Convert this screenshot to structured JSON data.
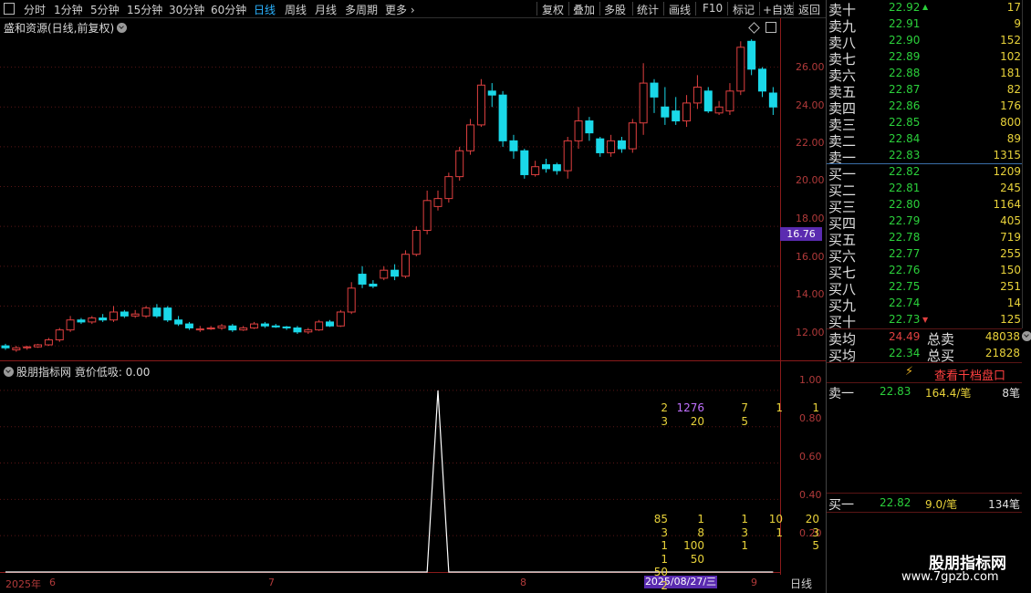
{
  "toolbar": {
    "periods": [
      "分时",
      "1分钟",
      "5分钟",
      "15分钟",
      "30分钟",
      "60分钟",
      "日线",
      "周线",
      "月线",
      "多周期",
      "更多"
    ],
    "active_period": "日线",
    "right_buttons": [
      "复权",
      "叠加",
      "多股",
      "统计",
      "画线",
      "F10",
      "标记",
      "+自选",
      "返回"
    ]
  },
  "main_chart": {
    "title": "盛和资源(日线,前复权)",
    "y_ticks": [
      "26.00",
      "24.00",
      "22.00",
      "20.00",
      "18.00",
      "16.00",
      "14.00",
      "12.00"
    ],
    "current_price_tag": "16.76"
  },
  "sub_chart": {
    "title": "股朋指标网 竟价低吸: 0.00",
    "y_ticks": [
      "1.00",
      "0.80",
      "0.60",
      "0.40",
      "0.20"
    ]
  },
  "date_axis": {
    "labels": [
      "2025年",
      "6",
      "7",
      "8",
      "9"
    ],
    "highlight": "2025/08/27/三",
    "period": "日线"
  },
  "order_book": {
    "sells": [
      {
        "label": "卖十",
        "price": "22.92",
        "vol": "17"
      },
      {
        "label": "卖九",
        "price": "22.91",
        "vol": "9"
      },
      {
        "label": "卖八",
        "price": "22.90",
        "vol": "152"
      },
      {
        "label": "卖七",
        "price": "22.89",
        "vol": "102"
      },
      {
        "label": "卖六",
        "price": "22.88",
        "vol": "181"
      },
      {
        "label": "卖五",
        "price": "22.87",
        "vol": "82"
      },
      {
        "label": "卖四",
        "price": "22.86",
        "vol": "176"
      },
      {
        "label": "卖三",
        "price": "22.85",
        "vol": "800"
      },
      {
        "label": "卖二",
        "price": "22.84",
        "vol": "89"
      },
      {
        "label": "卖一",
        "price": "22.83",
        "vol": "1315"
      }
    ],
    "buys": [
      {
        "label": "买一",
        "price": "22.82",
        "vol": "1209"
      },
      {
        "label": "买二",
        "price": "22.81",
        "vol": "245"
      },
      {
        "label": "买三",
        "price": "22.80",
        "vol": "1164"
      },
      {
        "label": "买四",
        "price": "22.79",
        "vol": "405"
      },
      {
        "label": "买五",
        "price": "22.78",
        "vol": "719"
      },
      {
        "label": "买六",
        "price": "22.77",
        "vol": "255"
      },
      {
        "label": "买七",
        "price": "22.76",
        "vol": "150"
      },
      {
        "label": "买八",
        "price": "22.75",
        "vol": "251"
      },
      {
        "label": "买九",
        "price": "22.74",
        "vol": "14"
      },
      {
        "label": "买十",
        "price": "22.73",
        "vol": "125"
      }
    ],
    "avg_sell": {
      "label": "卖均",
      "price": "24.49",
      "tot_label": "总卖",
      "tot": "48038"
    },
    "avg_buy": {
      "label": "买均",
      "price": "22.34",
      "tot_label": "总买",
      "tot": "21828"
    },
    "level2_link": "查看千档盘口",
    "sell1_detail": {
      "label": "卖一",
      "price": "22.83",
      "amt": "164.4/笔",
      "count": "8笔"
    },
    "sell1_queue": [
      [
        "2",
        "1276",
        "7",
        "1",
        "1"
      ],
      [
        "3",
        "20",
        "5"
      ]
    ],
    "buy1_detail": {
      "label": "买一",
      "price": "22.82",
      "amt": "9.0/笔",
      "count": "134笔"
    },
    "buy1_queue": [
      [
        "85",
        "1",
        "1",
        "10",
        "20"
      ],
      [
        "3",
        "8",
        "3",
        "1",
        "3"
      ],
      [
        "1",
        "100",
        "1",
        "",
        "5"
      ],
      [
        "1",
        "50"
      ],
      [
        "50"
      ],
      [
        "2"
      ]
    ]
  },
  "watermark": {
    "name": "股朋指标网",
    "url": "www.7gpzb.com"
  },
  "colors": {
    "up": "#e04040",
    "down": "#1ad8e8",
    "green": "#2bd03b",
    "yellow": "#e8d23a",
    "accent": "#2bb3ff",
    "highlight": "#5a2bb0"
  },
  "chart_data": [
    {
      "type": "candlestick",
      "title": "盛和资源(日线,前复权)",
      "ylim": [
        11.5,
        28
      ],
      "candles": [
        [
          12.0,
          11.9,
          11.8,
          12.1
        ],
        [
          11.8,
          11.9,
          11.7,
          12.0
        ],
        [
          11.9,
          11.95,
          11.8,
          12.0
        ],
        [
          11.95,
          12.05,
          11.9,
          12.1
        ],
        [
          12.05,
          12.3,
          12.0,
          12.4
        ],
        [
          12.3,
          12.8,
          12.2,
          12.9
        ],
        [
          12.8,
          13.3,
          12.7,
          13.5
        ],
        [
          13.3,
          13.2,
          13.1,
          13.4
        ],
        [
          13.2,
          13.4,
          13.1,
          13.5
        ],
        [
          13.4,
          13.3,
          13.2,
          13.6
        ],
        [
          13.3,
          13.7,
          13.2,
          14.0
        ],
        [
          13.7,
          13.5,
          13.4,
          13.8
        ],
        [
          13.5,
          13.6,
          13.4,
          13.8
        ],
        [
          13.5,
          13.9,
          13.4,
          14.0
        ],
        [
          13.9,
          13.5,
          13.4,
          14.1
        ],
        [
          13.9,
          13.3,
          13.2,
          14.0
        ],
        [
          13.3,
          13.1,
          13.0,
          13.5
        ],
        [
          13.1,
          12.9,
          12.8,
          13.2
        ],
        [
          12.8,
          12.85,
          12.7,
          13.0
        ],
        [
          12.85,
          12.9,
          12.8,
          13.0
        ],
        [
          12.9,
          13.0,
          12.8,
          13.1
        ],
        [
          13.0,
          12.8,
          12.7,
          13.1
        ],
        [
          12.8,
          12.9,
          12.75,
          13.0
        ],
        [
          12.9,
          13.1,
          12.85,
          13.2
        ],
        [
          13.1,
          13.0,
          12.9,
          13.2
        ],
        [
          13.0,
          12.95,
          12.9,
          13.1
        ],
        [
          12.95,
          12.9,
          12.8,
          13.0
        ],
        [
          12.9,
          12.7,
          12.6,
          13.0
        ],
        [
          12.7,
          12.8,
          12.6,
          12.9
        ],
        [
          12.8,
          13.2,
          12.75,
          13.3
        ],
        [
          13.2,
          13.0,
          12.95,
          13.3
        ],
        [
          13.0,
          13.7,
          12.95,
          13.8
        ],
        [
          13.7,
          14.9,
          13.6,
          15.2
        ],
        [
          15.6,
          15.1,
          14.9,
          16.0
        ],
        [
          15.1,
          15.0,
          14.9,
          15.3
        ],
        [
          15.4,
          15.8,
          15.3,
          16.0
        ],
        [
          15.8,
          15.5,
          15.3,
          16.1
        ],
        [
          15.5,
          16.6,
          15.4,
          16.8
        ],
        [
          16.6,
          17.8,
          16.5,
          18.0
        ],
        [
          17.8,
          19.3,
          17.6,
          19.8
        ],
        [
          19.0,
          19.4,
          18.8,
          19.8
        ],
        [
          19.4,
          20.5,
          19.2,
          20.7
        ],
        [
          20.5,
          21.8,
          20.3,
          22.0
        ],
        [
          21.8,
          23.1,
          21.6,
          23.4
        ],
        [
          23.1,
          25.1,
          23.0,
          25.4
        ],
        [
          24.8,
          24.6,
          24.0,
          25.2
        ],
        [
          24.6,
          22.3,
          22.0,
          24.8
        ],
        [
          22.3,
          21.8,
          21.4,
          22.6
        ],
        [
          21.8,
          20.6,
          20.4,
          21.9
        ],
        [
          20.6,
          21.0,
          20.5,
          21.3
        ],
        [
          21.1,
          20.9,
          20.7,
          21.4
        ],
        [
          21.1,
          20.8,
          20.6,
          21.2
        ],
        [
          20.8,
          22.3,
          20.4,
          22.5
        ],
        [
          22.3,
          23.3,
          21.9,
          24.0
        ],
        [
          23.3,
          22.7,
          22.3,
          23.5
        ],
        [
          22.4,
          21.7,
          21.5,
          22.5
        ],
        [
          21.7,
          22.3,
          21.5,
          22.6
        ],
        [
          22.3,
          21.9,
          21.7,
          22.5
        ],
        [
          21.9,
          23.2,
          21.7,
          23.4
        ],
        [
          23.2,
          25.2,
          22.6,
          26.2
        ],
        [
          25.2,
          24.5,
          23.7,
          25.4
        ],
        [
          24.0,
          23.5,
          23.1,
          25.0
        ],
        [
          23.8,
          23.3,
          23.1,
          24.5
        ],
        [
          23.3,
          24.2,
          23.0,
          24.6
        ],
        [
          24.2,
          25.0,
          23.9,
          25.6
        ],
        [
          24.8,
          23.8,
          23.7,
          25.0
        ],
        [
          23.7,
          24.0,
          23.6,
          24.3
        ],
        [
          23.8,
          24.8,
          23.6,
          25.2
        ],
        [
          24.8,
          27.0,
          24.6,
          27.3
        ],
        [
          27.3,
          25.9,
          25.6,
          27.4
        ],
        [
          25.9,
          24.8,
          24.5,
          26.0
        ],
        [
          24.7,
          24.0,
          23.6,
          25.0
        ]
      ]
    },
    {
      "type": "line",
      "title": "股朋指标网 竟价低吸",
      "ylim": [
        0,
        1.1
      ],
      "series": [
        {
          "values": [
            0,
            0,
            0,
            0,
            0,
            0,
            0,
            0,
            0,
            0,
            0,
            0,
            0,
            0,
            0,
            0,
            0,
            0,
            0,
            0,
            0,
            0,
            0,
            0,
            0,
            0,
            0,
            0,
            0,
            0,
            0,
            0,
            0,
            0,
            0,
            0,
            0,
            0,
            0,
            0,
            1,
            0,
            0,
            0,
            0,
            0,
            0,
            0,
            0,
            0,
            0,
            0,
            0,
            0,
            0,
            0,
            0,
            0,
            0,
            0,
            0,
            0,
            0,
            0,
            0,
            0,
            0,
            0,
            0,
            0,
            0,
            0
          ]
        }
      ]
    }
  ]
}
